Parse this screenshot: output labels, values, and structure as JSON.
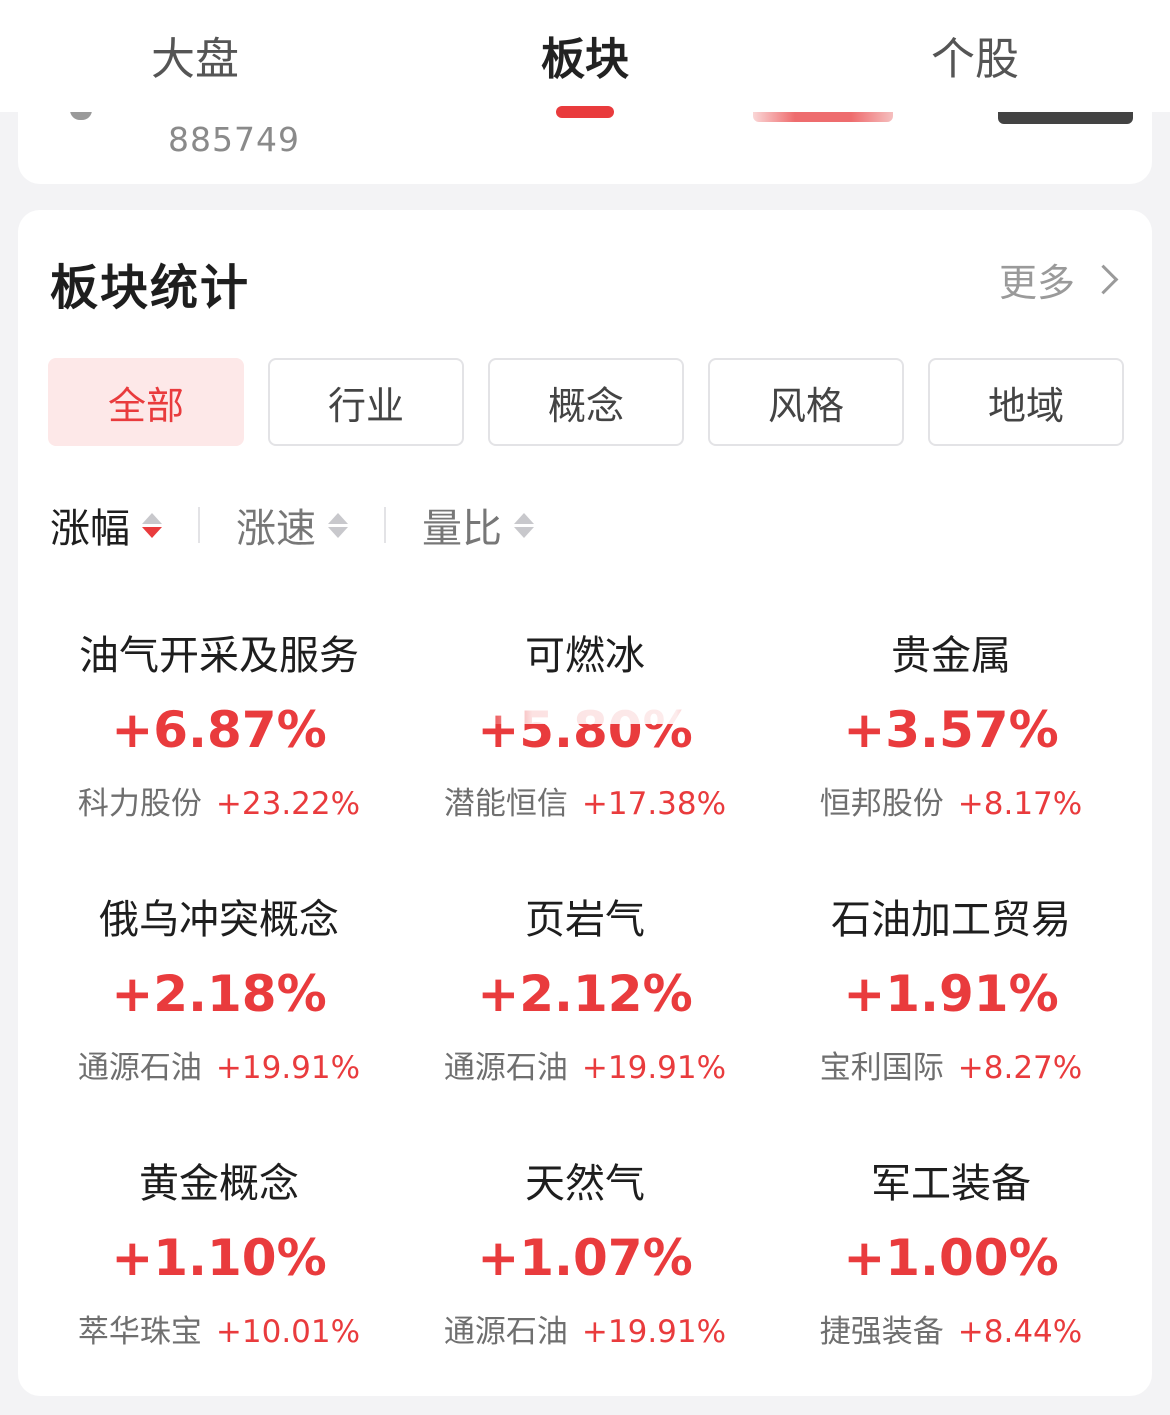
{
  "tabs": [
    {
      "label": "大盘",
      "active": false
    },
    {
      "label": "板块",
      "active": true
    },
    {
      "label": "个股",
      "active": false
    }
  ],
  "prev_card": {
    "code": "885749"
  },
  "section": {
    "title": "板块统计",
    "more_label": "更多"
  },
  "filters": [
    {
      "label": "全部",
      "active": true
    },
    {
      "label": "行业",
      "active": false
    },
    {
      "label": "概念",
      "active": false
    },
    {
      "label": "风格",
      "active": false
    },
    {
      "label": "地域",
      "active": false
    }
  ],
  "sorts": [
    {
      "label": "涨幅",
      "active": true
    },
    {
      "label": "涨速",
      "active": false
    },
    {
      "label": "量比",
      "active": false
    }
  ],
  "sectors": [
    {
      "name": "油气开采及服务",
      "change": "+6.87%",
      "leader": "科力股份",
      "leader_change": "+23.22%"
    },
    {
      "name": "可燃冰",
      "change": "+5.80%",
      "leader": "潜能恒信",
      "leader_change": "+17.38%"
    },
    {
      "name": "贵金属",
      "change": "+3.57%",
      "leader": "恒邦股份",
      "leader_change": "+8.17%"
    },
    {
      "name": "俄乌冲突概念",
      "change": "+2.18%",
      "leader": "通源石油",
      "leader_change": "+19.91%"
    },
    {
      "name": "页岩气",
      "change": "+2.12%",
      "leader": "通源石油",
      "leader_change": "+19.91%"
    },
    {
      "name": "石油加工贸易",
      "change": "+1.91%",
      "leader": "宝利国际",
      "leader_change": "+8.27%"
    },
    {
      "name": "黄金概念",
      "change": "+1.10%",
      "leader": "萃华珠宝",
      "leader_change": "+10.01%"
    },
    {
      "name": "天然气",
      "change": "+1.07%",
      "leader": "通源石油",
      "leader_change": "+19.91%"
    },
    {
      "name": "军工装备",
      "change": "+1.00%",
      "leader": "捷强装备",
      "leader_change": "+8.44%"
    }
  ],
  "colors": {
    "accent": "#e93b3d",
    "chip_active_bg": "#fde8e8",
    "background": "#f3f3f5"
  }
}
